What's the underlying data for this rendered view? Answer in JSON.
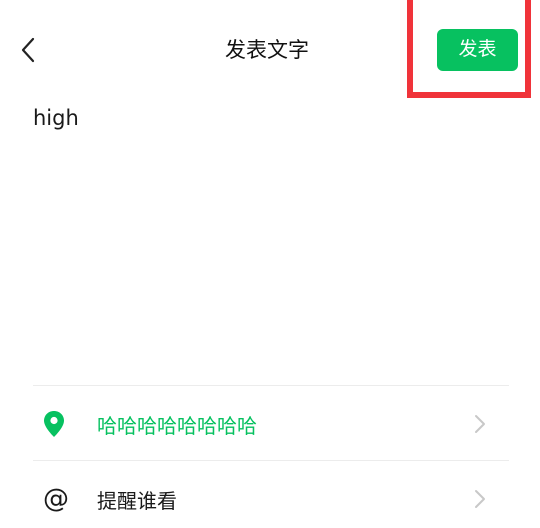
{
  "header": {
    "title": "发表文字",
    "publish_label": "发表"
  },
  "body": {
    "text": "high"
  },
  "location": {
    "icon": "location-pin-icon",
    "label": "哈哈哈哈哈哈哈哈"
  },
  "mention": {
    "icon": "at-icon",
    "symbol": "@",
    "label": "提醒谁看"
  },
  "colors": {
    "accent": "#07c160",
    "highlight": "#f0333a"
  }
}
